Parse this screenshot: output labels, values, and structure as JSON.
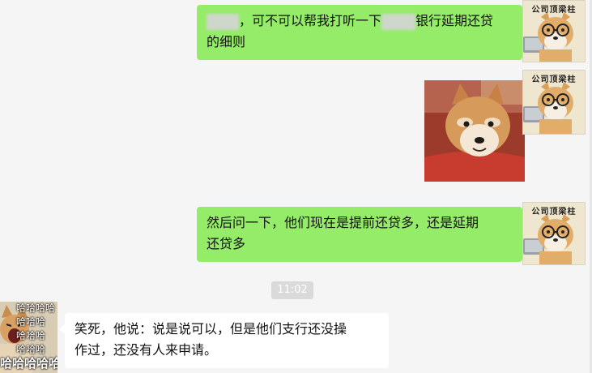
{
  "messages": [
    {
      "side": "right",
      "text_before": "，可不可以帮我打听一下",
      "text_after": "银行延期还贷",
      "text_line2": "的细则"
    },
    {
      "side": "right",
      "type": "image",
      "content": "shiba-dog-photo"
    },
    {
      "side": "right",
      "text_line1": "然后问一下，他们现在是提前还贷多，还是延期",
      "text_line2": "还贷多"
    },
    {
      "side": "left",
      "text_line1": "笑死，他说：说是说可以，但是他们支行还没操",
      "text_line2": "作过，还没有人来申请。"
    }
  ],
  "timestamp": "11:02",
  "my_avatar": {
    "caption": "公司顶梁柱",
    "icon": "shiba-glasses-laptop"
  },
  "their_avatar": {
    "icon": "laughing-cat",
    "overlay_lines": [
      "哈哈哈哈",
      "哈哈哈",
      "哈哈哈",
      "哈哈哈"
    ],
    "overlay_big": "哈哈哈哈哈"
  },
  "colors": {
    "background": "#f5f5f5",
    "my_bubble": "#95ec69",
    "their_bubble": "#ffffff",
    "time_chip": "#dadada"
  }
}
